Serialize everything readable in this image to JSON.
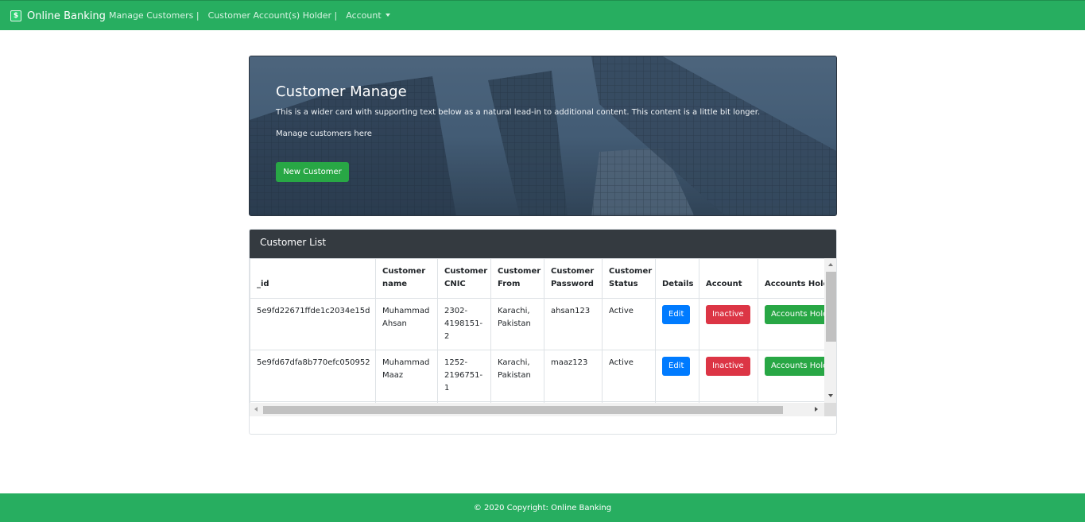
{
  "brand": {
    "name": "Online Banking",
    "icon": "dollar-icon"
  },
  "nav": {
    "items": [
      "Manage Customers |",
      "Customer Account(s) Holder |"
    ],
    "dropdown_label": "Account"
  },
  "hero": {
    "title": "Customer Manage",
    "text": "This is a wider card with supporting text below as a natural lead-in to additional content. This content is a little bit longer.",
    "subtext": "Manage customers here",
    "button_label": "New Customer"
  },
  "customer_list": {
    "title": "Customer List",
    "columns": {
      "id": "_id",
      "name": "Customer name",
      "cnic": "Customer CNIC",
      "from": "Customer From",
      "password": "Customer Password",
      "status": "Customer Status",
      "details": "Details",
      "account": "Account",
      "holders": "Accounts Holders"
    },
    "rows": [
      {
        "id": "5e9fd22671ffde1c2034e15d",
        "name": "Muhammad Ahsan",
        "cnic": "2302-4198151-2",
        "from": "Karachi, Pakistan",
        "password": "ahsan123",
        "status": "Active",
        "details_button": "Edit",
        "account_button": "Inactive",
        "holders_button": "Accounts Holders"
      },
      {
        "id": "5e9fd67dfa8b770efc050952",
        "name": "Muhammad Maaz",
        "cnic": "1252-2196751-1",
        "from": "Karachi, Pakistan",
        "password": "maaz123",
        "status": "Active",
        "details_button": "Edit",
        "account_button": "Inactive",
        "holders_button": "Accounts Holders"
      }
    ]
  },
  "footer": {
    "text": "© 2020 Copyright: Online Banking"
  },
  "colors": {
    "navbar": "#27ae60",
    "header_dark": "#343a40",
    "button_green": "#28a745",
    "button_blue": "#007bff",
    "button_red": "#dc3545"
  }
}
